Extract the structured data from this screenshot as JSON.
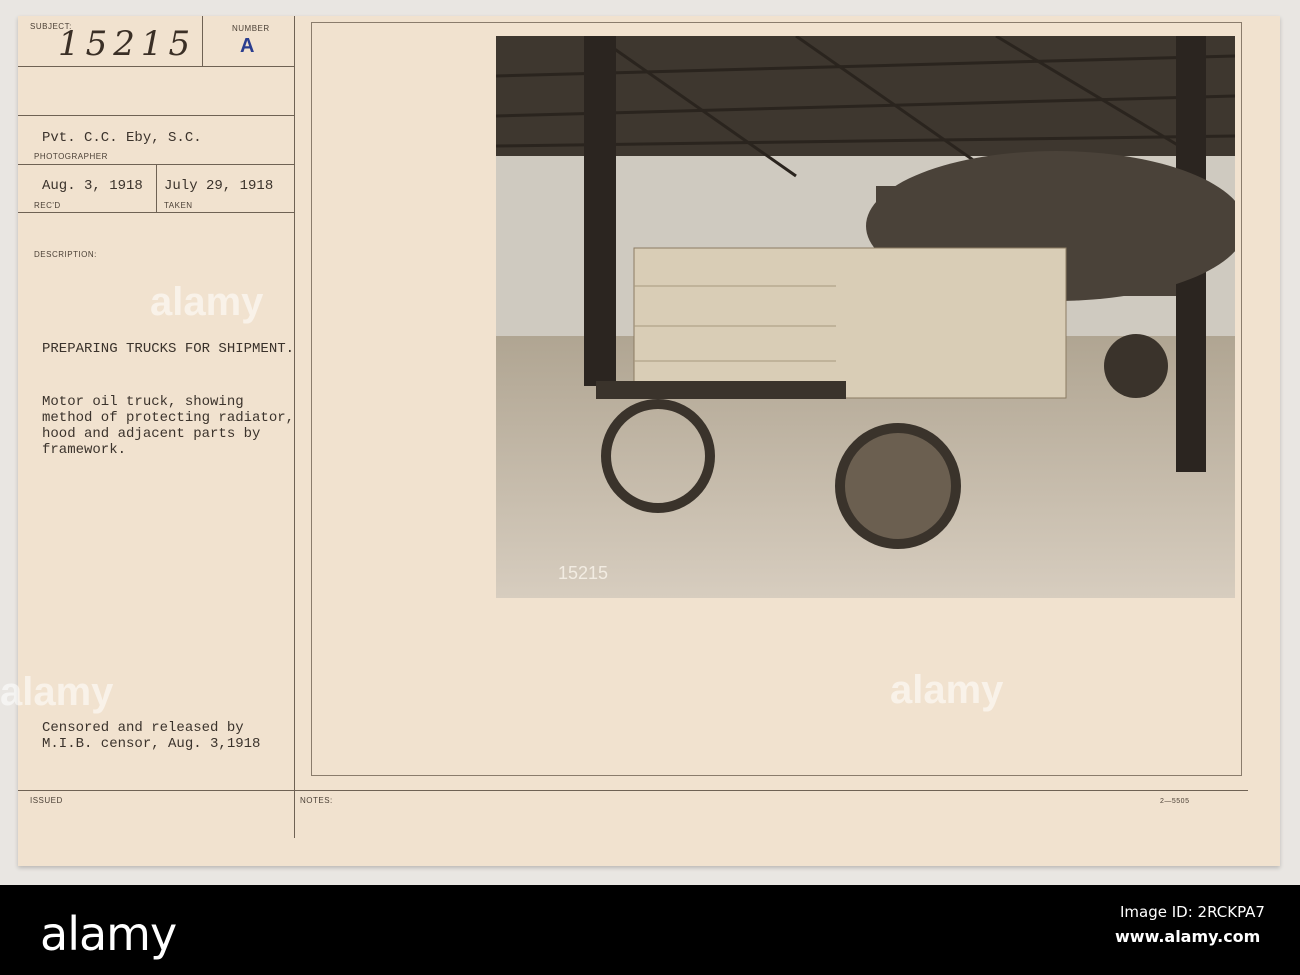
{
  "card": {
    "subject_label": "SUBJECT:",
    "subject_number": "15215",
    "number_label": "NUMBER",
    "number_value": "A",
    "photographer": "Pvt. C.C. Eby, S.C.",
    "photographer_label": "PHOTOGRAPHER",
    "received": "Aug. 3, 1918",
    "received_label": "REC'D",
    "taken": "July 29, 1918",
    "taken_label": "TAKEN",
    "description_label": "DESCRIPTION:",
    "heading": "PREPARING TRUCKS FOR SHIPMENT.",
    "description": "Motor oil truck, showing\nmethod of protecting radiator,\nhood and adjacent parts by\nframework.",
    "censor": "Censored and released by\nM.I.B. censor, Aug. 3,1918",
    "issued_label": "ISSUED",
    "notes_label": "NOTES:",
    "form_number": "2—5505",
    "photo_caption": "15215"
  },
  "watermark": "alamy",
  "footer": {
    "logo": "alamy",
    "image_id": "Image ID: 2RCKPA7",
    "url": "www.alamy.com"
  }
}
